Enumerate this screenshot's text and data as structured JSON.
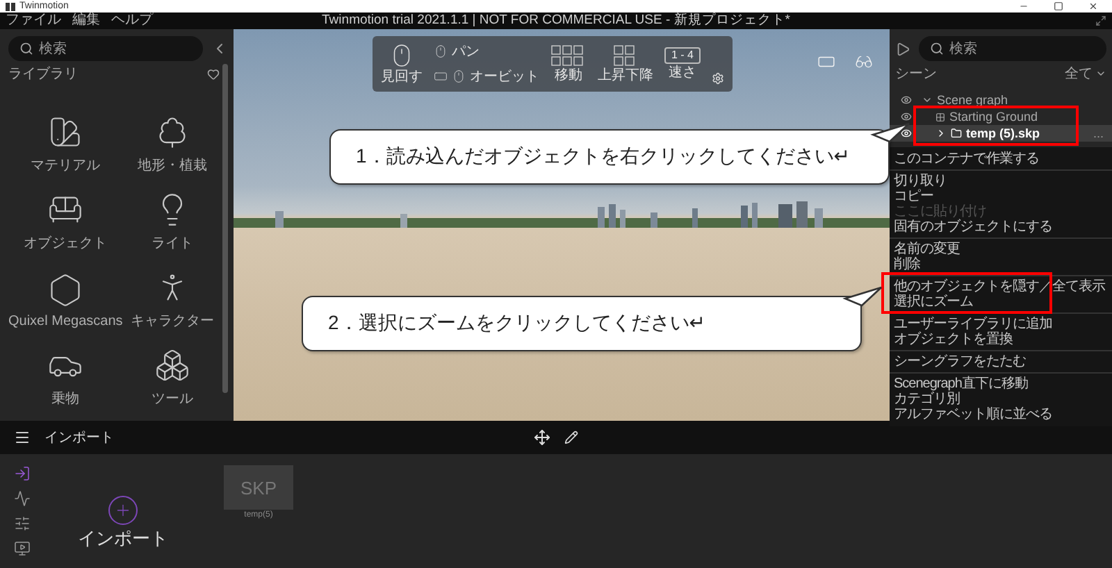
{
  "window": {
    "app_name": "Twinmotion",
    "title": "Twinmotion trial 2021.1.1 | NOT FOR COMMERCIAL USE - 新規プロジェクト*"
  },
  "menu": [
    "ファイル",
    "編集",
    "ヘルプ"
  ],
  "library": {
    "search": {
      "placeholder": "検索"
    },
    "heading": "ライブラリ",
    "items": [
      {
        "kind": "material",
        "label": "マテリアル"
      },
      {
        "kind": "vegetation",
        "label": "地形・植栽"
      },
      {
        "kind": "object",
        "label": "オブジェクト"
      },
      {
        "kind": "light",
        "label": "ライト"
      },
      {
        "kind": "quixel",
        "label": "Quixel Megascans"
      },
      {
        "kind": "character",
        "label": "キャラクター"
      },
      {
        "kind": "vehicle",
        "label": "乗物"
      },
      {
        "kind": "tool",
        "label": "ツール"
      }
    ]
  },
  "viewport": {
    "navigation": [
      {
        "kind": "look",
        "label": "見回す"
      },
      {
        "kind": "pan",
        "label": "パン"
      },
      {
        "kind": "orbit",
        "label": "オービット"
      },
      {
        "kind": "move",
        "label": "移動"
      },
      {
        "kind": "updown",
        "label": "上昇下降"
      },
      {
        "kind": "speed",
        "label": "速さ",
        "key": "1 - 4"
      }
    ]
  },
  "scene": {
    "search": {
      "placeholder": "検索"
    },
    "heading": "シーン",
    "filter": "全て",
    "tree": {
      "label": "Scene graph",
      "expanded": true,
      "selected": false,
      "children": [
        {
          "label": "Starting Ground",
          "selected": false
        },
        {
          "label": "temp (5).skp",
          "selected": true,
          "expanded": false,
          "more": "..."
        }
      ]
    }
  },
  "context_menu": {
    "sections": [
      [
        {
          "label": "このコンテナで作業する",
          "disabled": false
        }
      ],
      [
        {
          "label": "切り取り",
          "disabled": false
        },
        {
          "label": "コピー",
          "disabled": false
        },
        {
          "label": "ここに貼り付け",
          "disabled": true
        },
        {
          "label": "固有のオブジェクトにする",
          "disabled": false
        }
      ],
      [
        {
          "label": "名前の変更",
          "disabled": false
        },
        {
          "label": "削除",
          "disabled": false
        }
      ],
      [
        {
          "label": "他のオブジェクトを隠す／全て表示",
          "disabled": false
        },
        {
          "label": "選択にズーム",
          "disabled": false
        }
      ],
      [
        {
          "label": "ユーザーライブラリに追加",
          "disabled": false
        },
        {
          "label": "オブジェクトを置換",
          "disabled": false
        }
      ],
      [
        {
          "label": "シーングラフをたたむ",
          "disabled": false
        }
      ],
      [
        {
          "label": "Scenegraph直下に移動",
          "disabled": false
        },
        {
          "label": "カテゴリ別",
          "disabled": false
        },
        {
          "label": "アルファベット順に並べる",
          "disabled": false
        }
      ]
    ]
  },
  "callouts": [
    {
      "text": "1．読み込んだオブジェクトを右クリックしてください↵"
    },
    {
      "text": "2．選択にズームをクリックしてください↵"
    }
  ],
  "bottom_bar": {
    "title": "インポート"
  },
  "import_panel": {
    "tools": [
      {
        "kind": "import",
        "selected": true
      },
      {
        "kind": "animation",
        "selected": false
      },
      {
        "kind": "slider",
        "selected": false
      },
      {
        "kind": "screen",
        "selected": false
      }
    ],
    "import_button": "インポート",
    "files": [
      {
        "thumb": "SKP",
        "name": "temp(5)"
      }
    ]
  }
}
